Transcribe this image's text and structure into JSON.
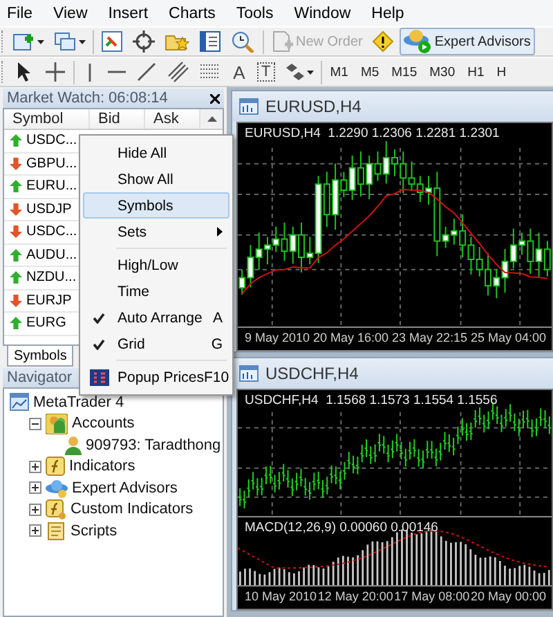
{
  "menu_bar": [
    "File",
    "View",
    "Insert",
    "Charts",
    "Tools",
    "Window",
    "Help"
  ],
  "toolbar": {
    "new_order": {
      "label": "New Order",
      "disabled": true
    },
    "expert_advisors": {
      "label": "Expert Advisors",
      "pressed": true
    }
  },
  "drawing_toolbar": {
    "text_tool": "A",
    "label_tool": "T",
    "timeframes": [
      "M1",
      "M5",
      "M15",
      "M30",
      "H1",
      "H"
    ]
  },
  "market_watch": {
    "title": "Market Watch: 06:08:14",
    "columns": [
      "Symbol",
      "Bid",
      "Ask"
    ],
    "rows": [
      {
        "symbol": "USDC...",
        "rising": true
      },
      {
        "symbol": "GBPU...",
        "rising": false
      },
      {
        "symbol": "EURU...",
        "rising": true
      },
      {
        "symbol": "USDJP",
        "rising": false
      },
      {
        "symbol": "USDC...",
        "rising": false
      },
      {
        "symbol": "AUDU...",
        "rising": true
      },
      {
        "symbol": "NZDU...",
        "rising": true
      },
      {
        "symbol": "EURJP",
        "rising": false
      },
      {
        "symbol": "EURG",
        "rising": true
      }
    ],
    "tab": "Symbols"
  },
  "context_menu": [
    {
      "kind": "item",
      "label": "Hide All",
      "selected": false,
      "checked": false
    },
    {
      "kind": "item",
      "label": "Show All",
      "selected": false,
      "checked": false
    },
    {
      "kind": "item",
      "label": "Symbols",
      "selected": true,
      "checked": false
    },
    {
      "kind": "submenu",
      "label": "Sets",
      "selected": false,
      "checked": false
    },
    {
      "kind": "separator"
    },
    {
      "kind": "item",
      "label": "High/Low",
      "selected": false,
      "checked": false
    },
    {
      "kind": "item",
      "label": "Time",
      "selected": false,
      "checked": false
    },
    {
      "kind": "item",
      "label": "Auto Arrange",
      "selected": false,
      "checked": true,
      "shortcut": "A"
    },
    {
      "kind": "item",
      "label": "Grid",
      "selected": false,
      "checked": true,
      "shortcut": "G"
    },
    {
      "kind": "separator"
    },
    {
      "kind": "icon_item",
      "label": "Popup Prices",
      "selected": false,
      "checked": false,
      "shortcut": "F10"
    }
  ],
  "navigator": {
    "title": "Navigator",
    "tree": [
      {
        "kind": "terminal",
        "label": "MetaTrader 4",
        "children": [
          {
            "kind": "accounts",
            "label": "Accounts",
            "expanded": true,
            "children": [
              {
                "kind": "account",
                "label": "909793: Taradthong"
              }
            ]
          },
          {
            "kind": "indicators",
            "label": "Indicators",
            "expanded": false
          },
          {
            "kind": "experts",
            "label": "Expert Advisors",
            "expanded": false
          },
          {
            "kind": "custom",
            "label": "Custom Indicators",
            "expanded": false
          },
          {
            "kind": "scripts",
            "label": "Scripts",
            "expanded": false
          }
        ]
      }
    ]
  },
  "charts": [
    {
      "kind": "candles",
      "title": "EURUSD,H4",
      "header": "EURUSD,H4  1.2290 1.2306 1.2281 1.2301",
      "dates": [
        "9 May 2010",
        "20 May 16:00",
        "23 May 22:15",
        "25 May 04:00"
      ]
    },
    {
      "kind": "bars",
      "title": "USDCHF,H4",
      "header": "USDCHF,H4  1.1568 1.1573 1.1554 1.1556",
      "indicator": "MACD(12,26,9) 0.00060 0.00146",
      "dates": [
        "10 May 2010",
        "12 May 20:00",
        "17 May 08:00",
        "20 May 00:00"
      ]
    }
  ]
}
